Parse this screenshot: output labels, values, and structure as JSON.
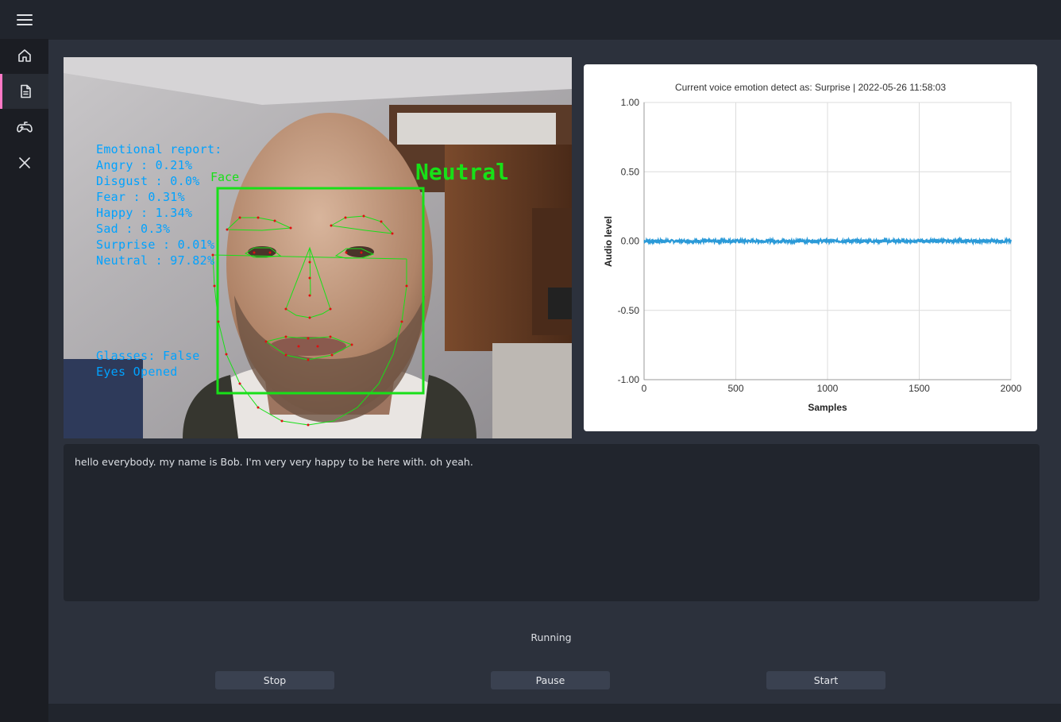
{
  "sidebar": {
    "items": [
      {
        "name": "home",
        "icon": "home-icon"
      },
      {
        "name": "document",
        "icon": "document-icon",
        "active": true
      },
      {
        "name": "gamepad",
        "icon": "gamepad-icon"
      },
      {
        "name": "close",
        "icon": "close-icon"
      }
    ],
    "accent": "#ff79c6"
  },
  "camera": {
    "report_title": "Emotional report:",
    "emotions": [
      "Angry : 0.21%",
      "Disgust : 0.0%",
      "Fear : 0.31%",
      "Happy : 1.34%",
      "Sad : 0.3%",
      "Surprise : 0.01%",
      "Neutral : 97.82%"
    ],
    "glasses": "Glasses: False",
    "eyes": "Eyes Opened",
    "face_label": "Face",
    "emotion_label": "Neutral"
  },
  "chart_data": {
    "type": "scatter",
    "title": "Current voice emotion detect as: Surprise | 2022-05-26 11:58:03",
    "xlabel": "Samples",
    "ylabel": "Audio level",
    "xlim": [
      0,
      2000
    ],
    "ylim": [
      -1.0,
      1.0
    ],
    "xticks": [
      "0",
      "500",
      "1000",
      "1500",
      "2000"
    ],
    "yticks": [
      "1.00",
      "0.50",
      "0.00",
      "-0.50",
      "-1.00"
    ],
    "grid": true,
    "series": [
      {
        "color": "#2b9ad8",
        "x_range": [
          0,
          2000
        ],
        "y_approx": 0.0,
        "noise": 0.01
      }
    ]
  },
  "transcript": "hello everybody. my name is Bob. I'm very very happy to be here with. oh yeah.",
  "status": "Running",
  "buttons": {
    "stop": "Stop",
    "pause": "Pause",
    "start": "Start"
  }
}
